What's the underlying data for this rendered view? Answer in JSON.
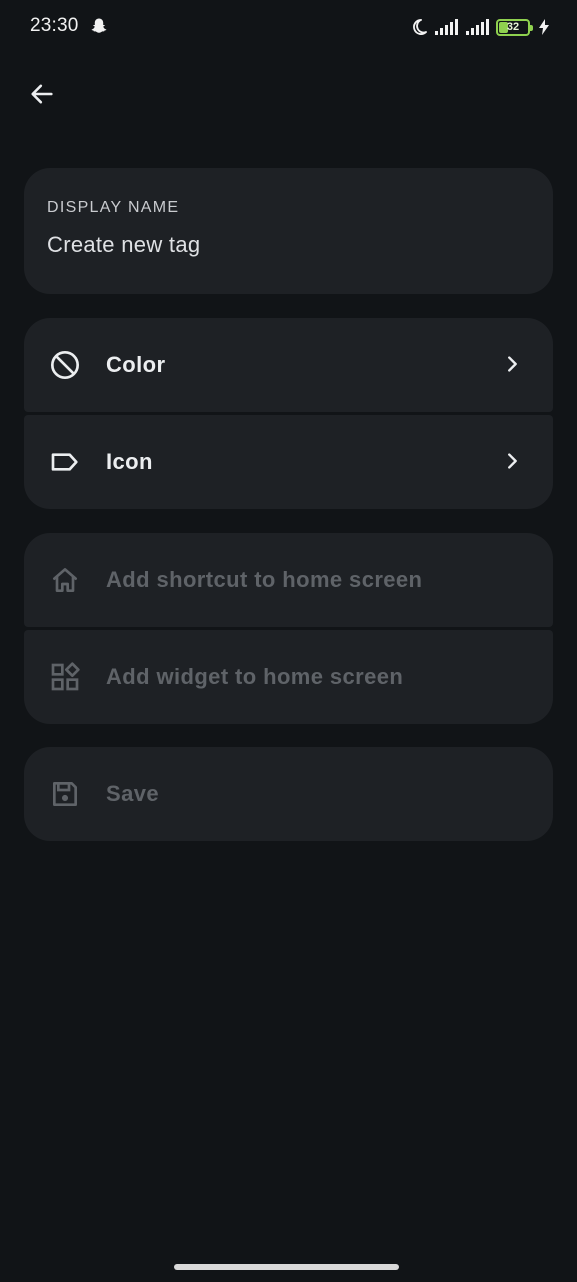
{
  "status_bar": {
    "time": "23:30",
    "battery_level": "32",
    "battery_fraction": 0.32,
    "icons": [
      "snapchat-icon",
      "moon-icon",
      "signal-icon",
      "signal-icon",
      "battery-icon",
      "charging-bolt-icon"
    ]
  },
  "header": {
    "back_icon": "arrow-back-icon"
  },
  "display_name": {
    "label": "DISPLAY NAME",
    "value": "Create new tag"
  },
  "appearance": [
    {
      "label": "Color",
      "icon": "block-icon",
      "enabled": true
    },
    {
      "label": "Icon",
      "icon": "label-tag-icon",
      "enabled": true
    }
  ],
  "shortcuts": [
    {
      "label": "Add shortcut to home screen",
      "icon": "home-icon",
      "enabled": false
    },
    {
      "label": "Add widget to home screen",
      "icon": "widgets-icon",
      "enabled": false
    }
  ],
  "actions": {
    "save_label": "Save",
    "save_icon": "save-icon",
    "save_enabled": false
  },
  "colors": {
    "background": "#111417",
    "card": "#1e2125",
    "text_primary": "#eceef0",
    "text_disabled": "#5f6368",
    "battery_accent": "#8fd14f"
  }
}
